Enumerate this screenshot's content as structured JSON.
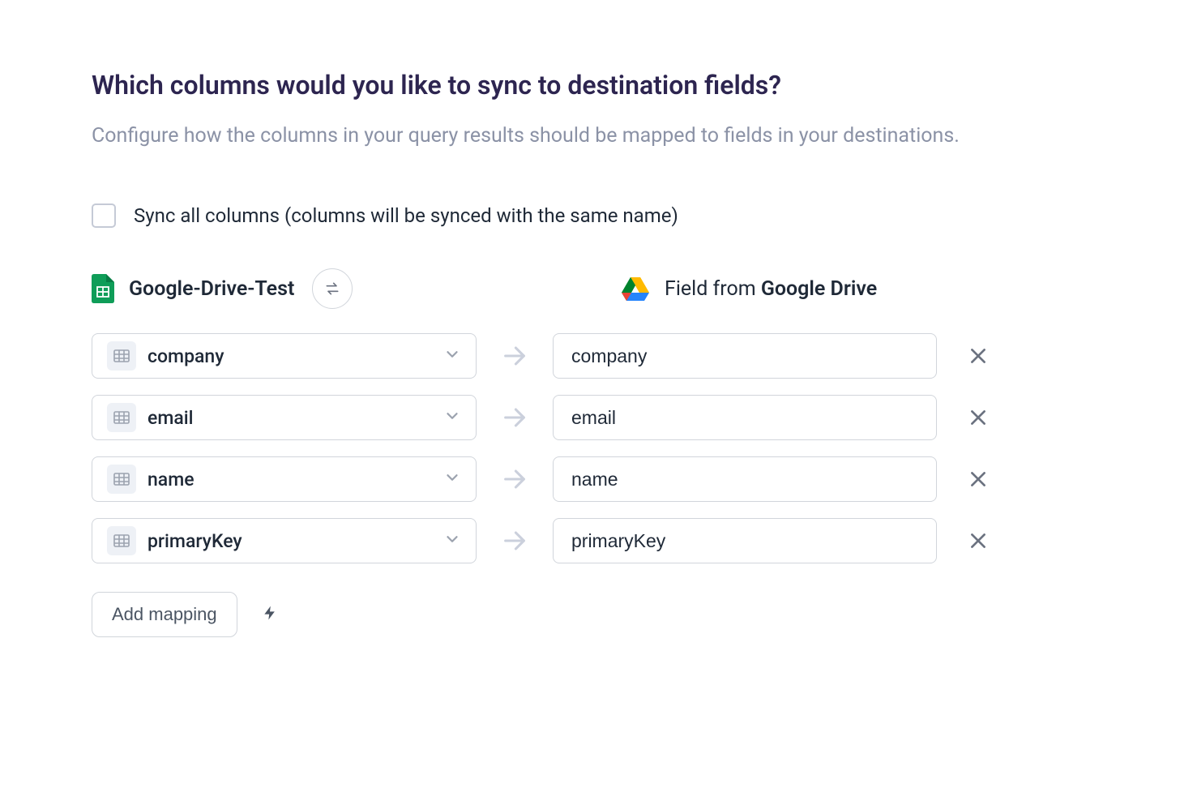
{
  "title": "Which columns would you like to sync to destination fields?",
  "subtitle": "Configure how the columns in your query results should be mapped to fields in your destinations.",
  "sync_all": {
    "label": "Sync all columns (columns will be synced with the same name)",
    "checked": false
  },
  "source": {
    "label": "Google-Drive-Test",
    "icon": "google-sheets-icon"
  },
  "destination": {
    "label_prefix": "Field from ",
    "label_bold": "Google Drive",
    "icon": "google-drive-icon"
  },
  "mappings": [
    {
      "source_column": "company",
      "dest_field": "company"
    },
    {
      "source_column": "email",
      "dest_field": "email"
    },
    {
      "source_column": "name",
      "dest_field": "name"
    },
    {
      "source_column": "primaryKey",
      "dest_field": "primaryKey"
    }
  ],
  "add_mapping_label": "Add mapping"
}
